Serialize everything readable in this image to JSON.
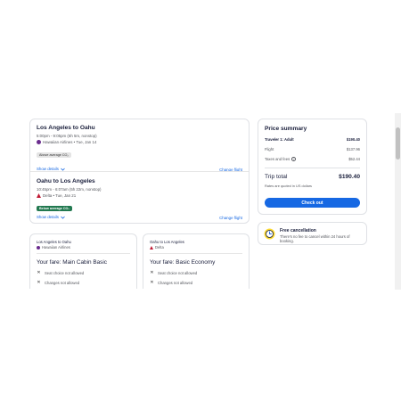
{
  "flights": [
    {
      "title": "Los Angeles to Oahu",
      "time": "5:00pm - 9:05pm (6h 5m, nonstop)",
      "airline_date": "Hawaiian Airlines • Tue, Jan 14",
      "co2_label": "Above average CO₂",
      "show_details": "Show details",
      "change_flight": "Change flight"
    },
    {
      "title": "Oahu to Los Angeles",
      "time": "10:45pm - 6:07am (5h 22m, nonstop)",
      "airline_date": "Delta • Tue, Jan 21",
      "co2_label": "Below average CO₂",
      "show_details": "Show details",
      "change_flight": "Change flight"
    }
  ],
  "fares": [
    {
      "route": "Los Angeles to Oahu",
      "airline": "Hawaiian Airlines",
      "fare_name": "Your fare: Main Cabin Basic",
      "restrictions": [
        "Seat choice not allowed",
        "Changes not allowed"
      ]
    },
    {
      "route": "Oahu to Los Angeles",
      "airline": "Delta",
      "fare_name": "Your fare: Basic Economy",
      "restrictions": [
        "Seat choice not allowed",
        "Changes not allowed"
      ]
    }
  ],
  "summary": {
    "title": "Price summary",
    "traveler_label": "Traveler 1: Adult",
    "traveler_total": "$190.40",
    "flight_label": "Flight",
    "flight_price": "$137.96",
    "taxes_label": "Taxes and fees",
    "taxes_price": "$52.44",
    "trip_total_label": "Trip total",
    "trip_total": "$190.40",
    "currency_note": "Rates are quoted in US dollars",
    "checkout_label": "Check out"
  },
  "cancellation": {
    "title": "Free cancellation",
    "text": "There's no fee to cancel within 24 hours of booking."
  },
  "colors": {
    "accent": "#1668e3",
    "co2_below": "#227950",
    "hawaiian": "#6a2c8e",
    "delta": "#c01933"
  },
  "icons": {
    "info": "info-icon",
    "close": "x-icon",
    "chevron": "chevron-down-icon",
    "clock": "clock-icon"
  }
}
